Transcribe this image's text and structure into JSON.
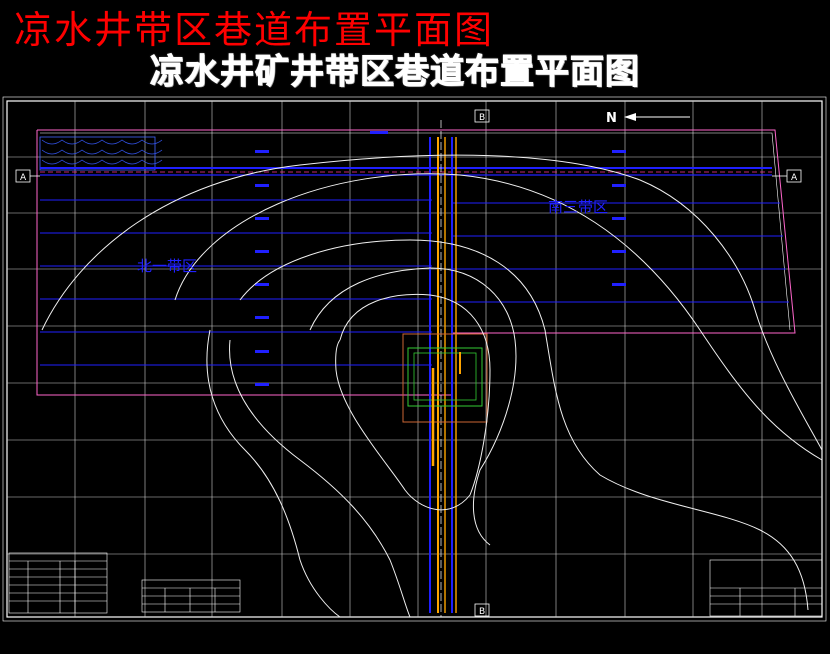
{
  "titles": {
    "red_title": "凉水井带区巷道布置平面图",
    "main_title": "凉水井矿井带区巷道布置平面图"
  },
  "zones": {
    "north": "北一带区",
    "south": "南三带区"
  },
  "section_marks": {
    "a_left": "A",
    "a_right": "A",
    "b_top": "B",
    "b_bottom": "B"
  },
  "north_arrow": "N",
  "colors": {
    "background": "#000000",
    "grid": "#ffffff",
    "roadway_blue": "#2020ff",
    "shaft_orange": "#ffa500",
    "red_title": "#ff0000",
    "contour": "#ffffff",
    "boundary_pink": "#ff66cc",
    "pillar_green": "#33cc33"
  }
}
